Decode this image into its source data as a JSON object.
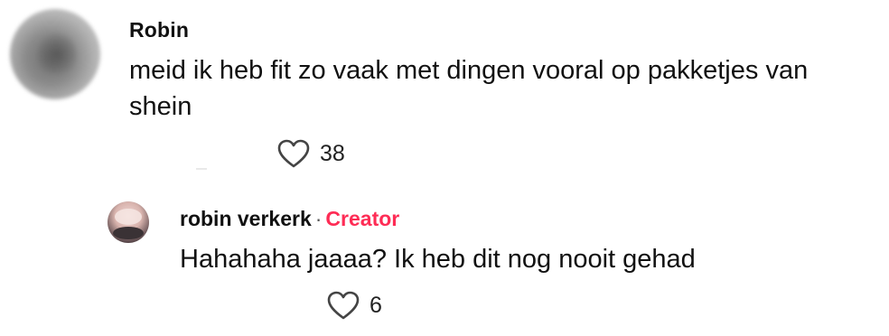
{
  "comment": {
    "author": "Robin",
    "text": "meid ik heb fit zo vaak met dingen vooral op pakketjes van shein",
    "like_count": "38",
    "avatar_icon": "blurred-avatar"
  },
  "reply": {
    "author": "robin verkerk",
    "separator": "·",
    "badge": "Creator",
    "badge_color": "#fe2c55",
    "text": "Hahahaha jaaaa? Ik heb dit nog nooit gehad",
    "like_count": "6",
    "avatar_icon": "profile-avatar"
  },
  "icons": {
    "like": "heart-outline-icon"
  }
}
